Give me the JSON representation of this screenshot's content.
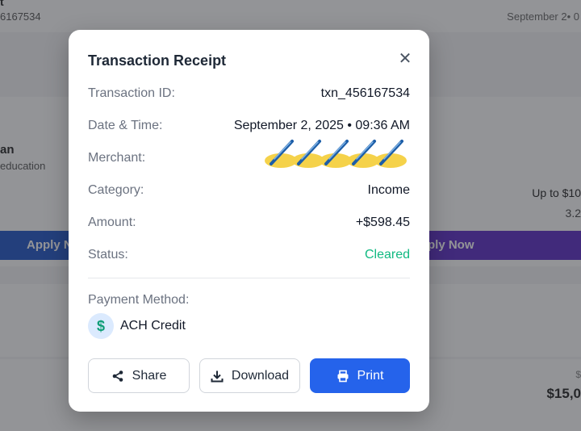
{
  "background": {
    "top_left_title": "t",
    "top_left_id": "6167534",
    "top_right_date": "September 2• 0",
    "card_name": "an",
    "card_sub": "education",
    "card_up_to": "Up to $10",
    "card_rate": "3.2",
    "apply_left": "Apply N",
    "apply_right": "ply Now",
    "bottom_amount": "$15,0",
    "bottom_dollar": "$"
  },
  "modal": {
    "title": "Transaction Receipt",
    "close_icon": "close-icon",
    "rows": [
      {
        "label": "Transaction ID:",
        "value": "txn_456167534"
      },
      {
        "label": "Date & Time:",
        "value": "September 2, 2025 • 09:36 AM"
      },
      {
        "label": "Merchant:",
        "value": ""
      },
      {
        "label": "Category:",
        "value": "Income"
      },
      {
        "label": "Amount:",
        "value": "+$598.45"
      },
      {
        "label": "Status:",
        "value": "Cleared"
      }
    ],
    "status_color": "#10b981",
    "payment_method_label": "Payment Method:",
    "payment_icon": "$",
    "payment_name": "ACH Credit",
    "buttons": {
      "share": "Share",
      "download": "Download",
      "print": "Print"
    },
    "accent_color": "#2563eb"
  }
}
